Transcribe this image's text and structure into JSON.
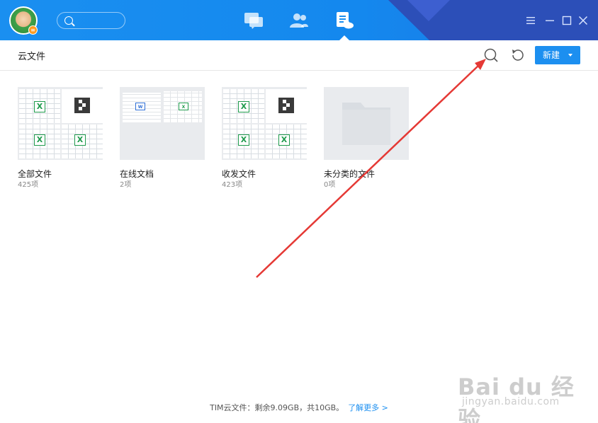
{
  "header": {
    "nav": [
      {
        "name": "messages"
      },
      {
        "name": "contacts"
      },
      {
        "name": "documents"
      }
    ],
    "controls": [
      "menu",
      "minimize",
      "maximize",
      "close"
    ]
  },
  "toolbar": {
    "title": "云文件",
    "new_label": "新建"
  },
  "folders": [
    {
      "name": "全部文件",
      "count": "425项"
    },
    {
      "name": "在线文档",
      "count": "2项"
    },
    {
      "name": "收发文件",
      "count": "423项"
    },
    {
      "name": "未分类的文件",
      "count": "0项"
    }
  ],
  "footer": {
    "storage_text": "TIM云文件：剩余9.09GB，共10GB。",
    "learn_more": "了解更多 >"
  },
  "watermark": {
    "line1": "Bai du 经验",
    "line2": "jingyan.baidu.com"
  },
  "colors": {
    "accent": "#1c8ff0",
    "titlebar": "#1a8ff0",
    "annotation_arrow": "#e53935",
    "excel_green": "#1f9b4c"
  }
}
